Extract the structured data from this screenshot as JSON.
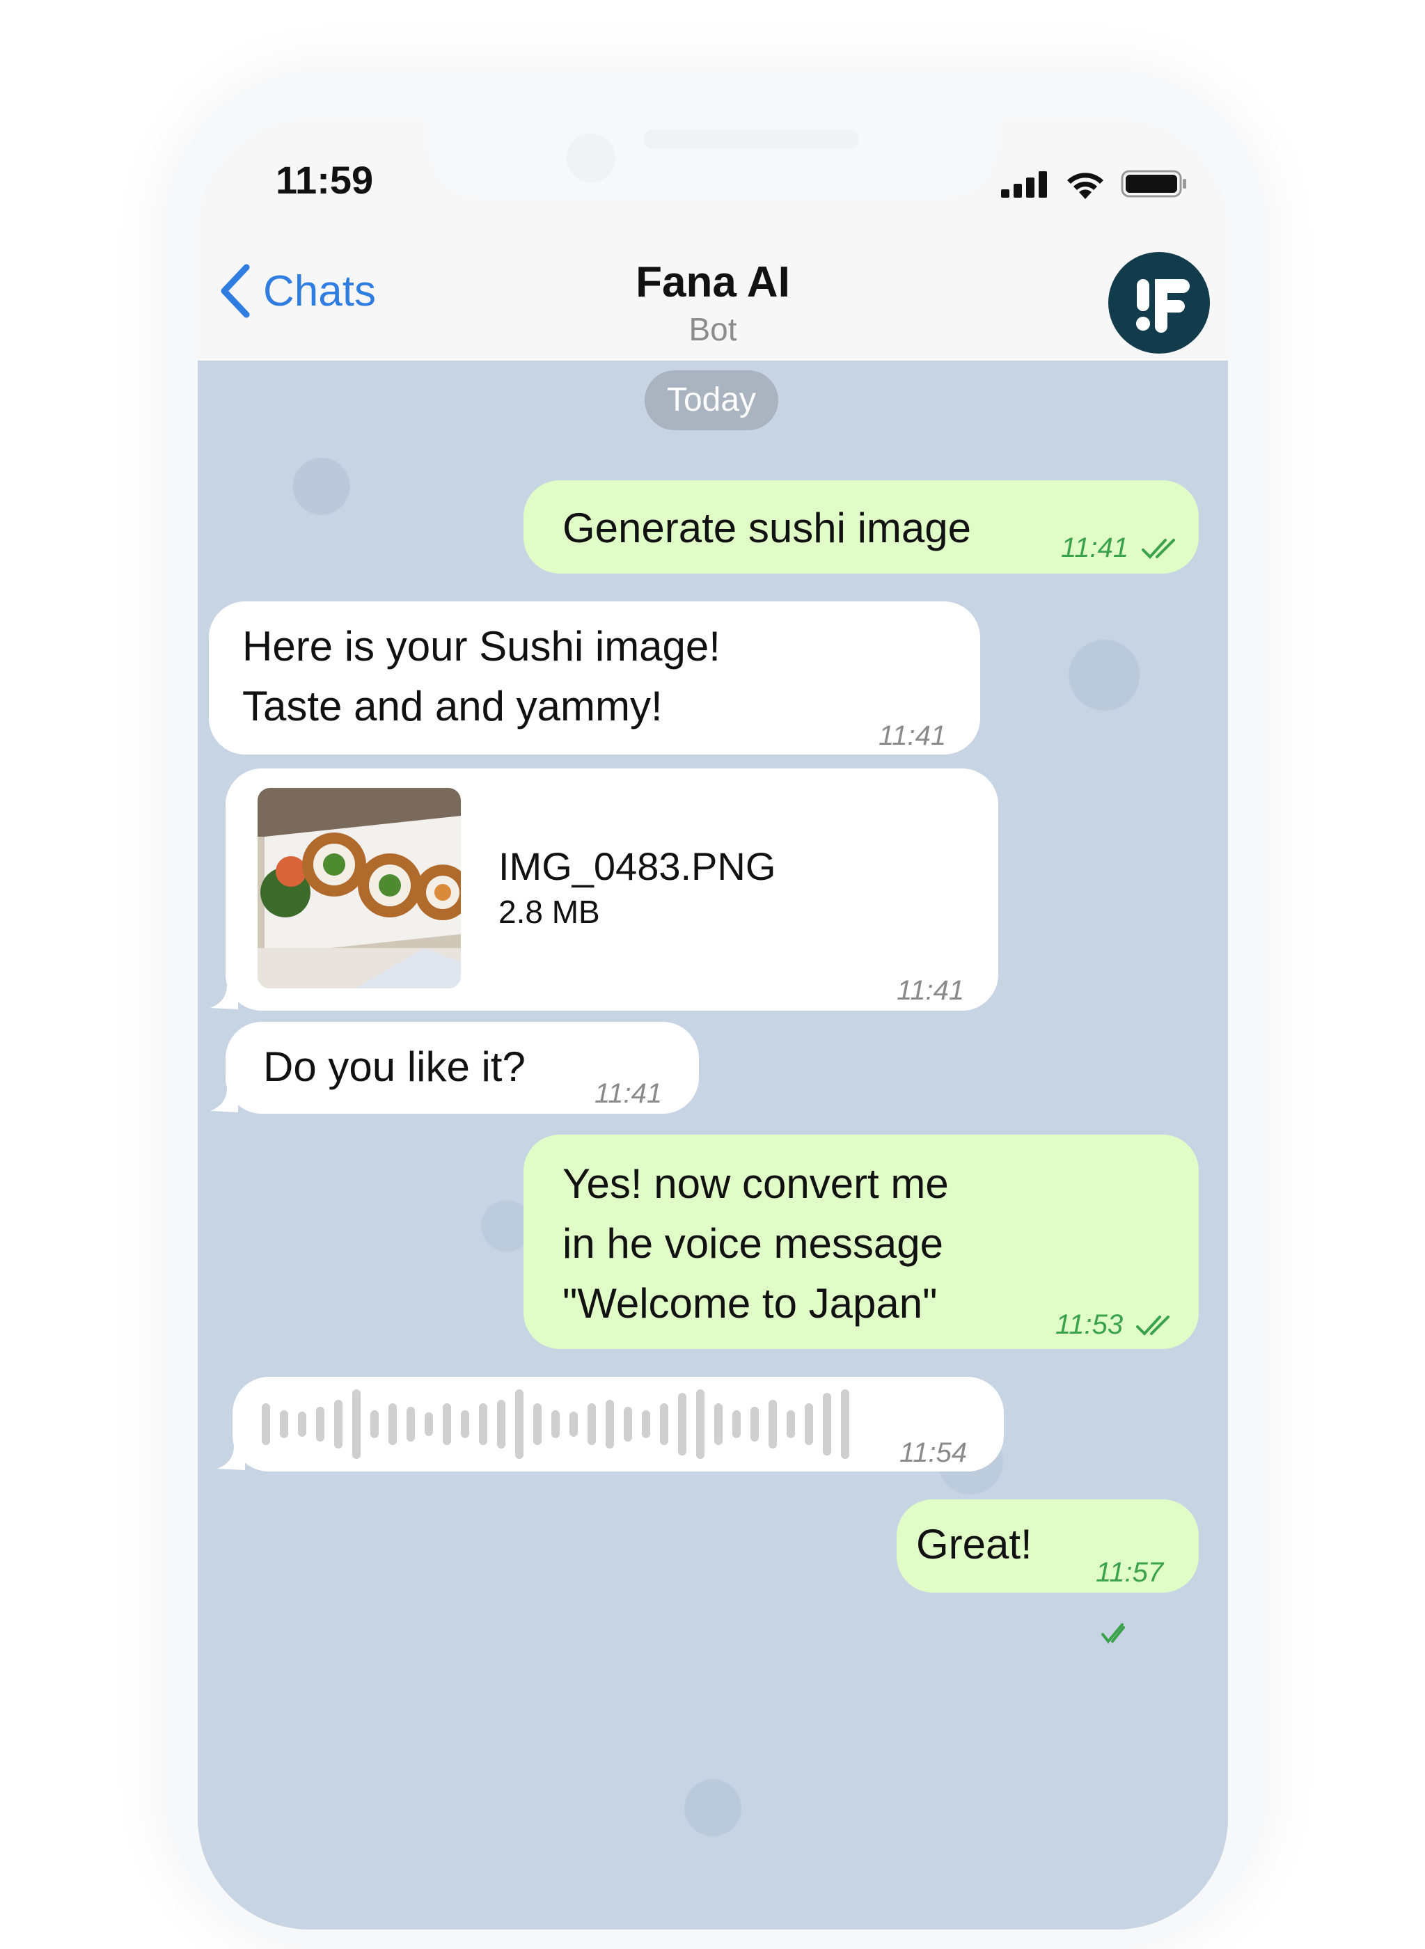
{
  "status_bar": {
    "time": "11:59"
  },
  "nav": {
    "back_label": "Chats",
    "title": "Fana AI",
    "subtitle": "Bot"
  },
  "date_divider": "Today",
  "messages": [
    {
      "text": "Generate sushi image",
      "time": "11:41"
    },
    {
      "line1": "Here is your Sushi image!",
      "line2": "Taste and and yammy!",
      "time": "11:41"
    },
    {
      "file_name": "IMG_0483.PNG",
      "file_size": "2.8 MB",
      "time": "11:41"
    },
    {
      "text": "Do you like it?",
      "time": "11:41"
    },
    {
      "line1": "Yes! now convert me",
      "line2": "in he voice message",
      "line3": "\"Welcome to Japan\"",
      "time": "11:53"
    },
    {
      "time": "11:54"
    },
    {
      "text": "Great!",
      "time": "11:57"
    }
  ],
  "colors": {
    "accent": "#2f7de1",
    "outgoing_bubble": "#e0fdc8",
    "incoming_bubble": "#ffffff",
    "chat_background": "#c7d4e3",
    "read_ticks": "#39a24a"
  },
  "icons": [
    "chevron-left-icon",
    "signal-icon",
    "wifi-icon",
    "battery-icon",
    "fana-logo-icon",
    "double-check-icon"
  ]
}
